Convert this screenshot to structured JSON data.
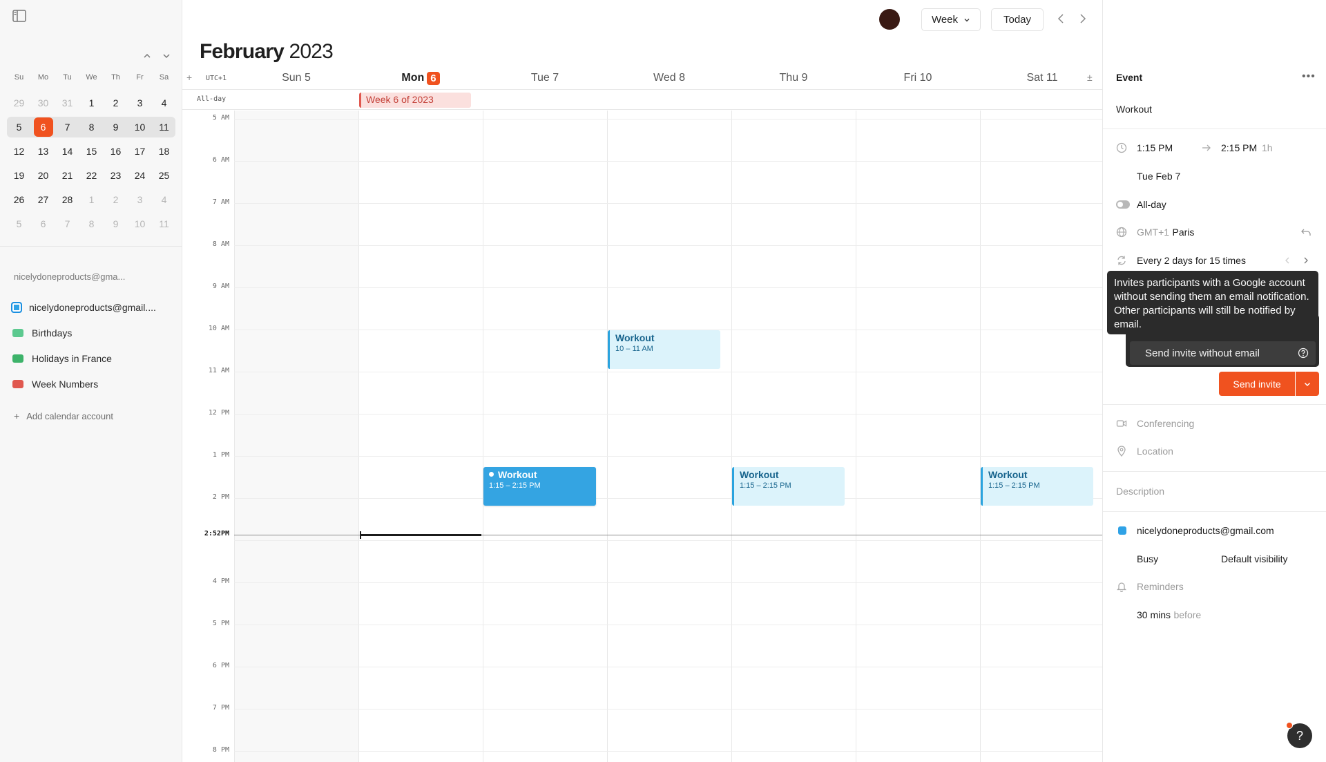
{
  "sidebar": {
    "mini_calendar": {
      "weekdays": [
        "Su",
        "Mo",
        "Tu",
        "We",
        "Th",
        "Fr",
        "Sa"
      ],
      "weeks": [
        [
          {
            "d": "29",
            "m": true
          },
          {
            "d": "30",
            "m": true
          },
          {
            "d": "31",
            "m": true
          },
          {
            "d": "1"
          },
          {
            "d": "2"
          },
          {
            "d": "3"
          },
          {
            "d": "4"
          }
        ],
        [
          {
            "d": "5"
          },
          {
            "d": "6",
            "t": true
          },
          {
            "d": "7"
          },
          {
            "d": "8"
          },
          {
            "d": "9"
          },
          {
            "d": "10"
          },
          {
            "d": "11"
          }
        ],
        [
          {
            "d": "12"
          },
          {
            "d": "13"
          },
          {
            "d": "14"
          },
          {
            "d": "15"
          },
          {
            "d": "16"
          },
          {
            "d": "17"
          },
          {
            "d": "18"
          }
        ],
        [
          {
            "d": "19"
          },
          {
            "d": "20"
          },
          {
            "d": "21"
          },
          {
            "d": "22"
          },
          {
            "d": "23"
          },
          {
            "d": "24"
          },
          {
            "d": "25"
          }
        ],
        [
          {
            "d": "26"
          },
          {
            "d": "27"
          },
          {
            "d": "28"
          },
          {
            "d": "1",
            "m": true
          },
          {
            "d": "2",
            "m": true
          },
          {
            "d": "3",
            "m": true
          },
          {
            "d": "4",
            "m": true
          }
        ],
        [
          {
            "d": "5",
            "m": true
          },
          {
            "d": "6",
            "m": true
          },
          {
            "d": "7",
            "m": true
          },
          {
            "d": "8",
            "m": true
          },
          {
            "d": "9",
            "m": true
          },
          {
            "d": "10",
            "m": true
          },
          {
            "d": "11",
            "m": true
          }
        ]
      ],
      "selected_week": 1
    },
    "account_label": "nicelydoneproducts@gma...",
    "calendars": [
      {
        "label": "nicelydoneproducts@gmail....",
        "kind": "main",
        "color": "#2fa2e6"
      },
      {
        "label": "Birthdays",
        "kind": "rss",
        "color": "#5cc98f"
      },
      {
        "label": "Holidays in France",
        "kind": "rss",
        "color": "#3db36a"
      },
      {
        "label": "Week Numbers",
        "kind": "rss",
        "color": "#e0584f"
      }
    ],
    "add_account": "Add calendar account"
  },
  "topbar": {
    "view_label": "Week",
    "today_label": "Today"
  },
  "header": {
    "month": "February",
    "year": "2023"
  },
  "week": {
    "timezone": "UTC+1",
    "allday_label": "All-day",
    "days": [
      {
        "label": "Sun 5"
      },
      {
        "label": "Mon",
        "badge": "6",
        "today": true
      },
      {
        "label": "Tue 7"
      },
      {
        "label": "Wed 8"
      },
      {
        "label": "Thu 9"
      },
      {
        "label": "Fri 10"
      },
      {
        "label": "Sat 11"
      }
    ],
    "allday_events": [
      {
        "day": 1,
        "title": "Week 6 of 2023"
      }
    ],
    "first_hour": 4.8,
    "hours": [
      {
        "label": "5 AM",
        "h": 5
      },
      {
        "label": "6 AM",
        "h": 6
      },
      {
        "label": "7 AM",
        "h": 7
      },
      {
        "label": "8 AM",
        "h": 8
      },
      {
        "label": "9 AM",
        "h": 9
      },
      {
        "label": "10 AM",
        "h": 10
      },
      {
        "label": "11 AM",
        "h": 11
      },
      {
        "label": "12 PM",
        "h": 12
      },
      {
        "label": "1 PM",
        "h": 13
      },
      {
        "label": "2 PM",
        "h": 14
      },
      {
        "label": "4 PM",
        "h": 16
      },
      {
        "label": "5 PM",
        "h": 17
      },
      {
        "label": "6 PM",
        "h": 18
      },
      {
        "label": "7 PM",
        "h": 19
      },
      {
        "label": "8 PM",
        "h": 20
      }
    ],
    "grid_lines": [
      5,
      6,
      7,
      8,
      9,
      10,
      11,
      12,
      13,
      14,
      15,
      16,
      17,
      18,
      19,
      20
    ],
    "now": {
      "label": "2:52PM",
      "hour": 14.867,
      "day": 1
    },
    "events": [
      {
        "day": 3,
        "start": 10,
        "end": 11,
        "title": "Workout",
        "time": "10 – 11 AM",
        "style": "light"
      },
      {
        "day": 2,
        "start": 13.25,
        "end": 14.25,
        "title": "Workout",
        "time": "1:15 – 2:15 PM",
        "style": "solid"
      },
      {
        "day": 4,
        "start": 13.25,
        "end": 14.25,
        "title": "Workout",
        "time": "1:15 – 2:15 PM",
        "style": "light"
      },
      {
        "day": 6,
        "start": 13.25,
        "end": 14.25,
        "title": "Workout",
        "time": "1:15 – 2:15 PM",
        "style": "light"
      }
    ]
  },
  "panel": {
    "title": "Event",
    "event_name": "Workout",
    "start_time": "1:15 PM",
    "end_time": "2:15 PM",
    "duration": "1h",
    "date": "Tue Feb 7",
    "allday_label": "All-day",
    "timezone_offset": "GMT+1",
    "timezone_city": "Paris",
    "recurrence": "Every 2 days for 15 times",
    "tooltip": "Invites participants with a Google account without sending them an email notification. Other participants will still be notified by email.",
    "menu_item": "Send invite without email",
    "send_label": "Send invite",
    "conferencing": "Conferencing",
    "location": "Location",
    "description": "Description",
    "calendar_account": "nicelydoneproducts@gmail.com",
    "calendar_color": "#2fa2e6",
    "busy": "Busy",
    "visibility": "Default visibility",
    "reminders": "Reminders",
    "reminder_value": "30 mins",
    "reminder_suffix": "before"
  },
  "help_label": "?",
  "colors": {
    "accent": "#f0521f",
    "event_blue": "#34a4e2",
    "event_light": "#dcf3fb"
  }
}
